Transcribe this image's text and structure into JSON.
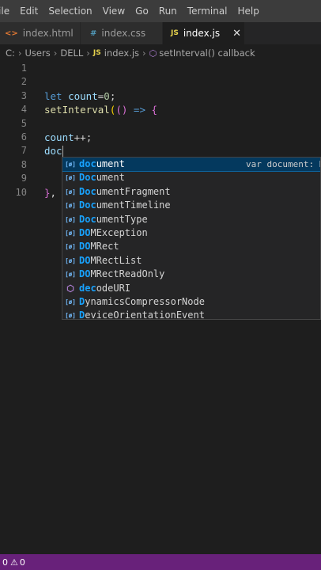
{
  "menu": [
    "File",
    "Edit",
    "Selection",
    "View",
    "Go",
    "Run",
    "Terminal",
    "Help"
  ],
  "tabs": [
    {
      "icon": "<>",
      "label": "index.html"
    },
    {
      "icon": "#",
      "label": "index.css"
    },
    {
      "icon": "JS",
      "label": "index.js",
      "close": "✕"
    }
  ],
  "breadcrumb": {
    "items": [
      "C:",
      "Users",
      "DELL",
      "index.js",
      "setInterval() callback"
    ],
    "sep": "›"
  },
  "editor": {
    "lines": [
      {
        "n": "1"
      },
      {
        "n": "2"
      },
      {
        "n": "3"
      },
      {
        "n": "4"
      },
      {
        "n": "5"
      },
      {
        "n": "6"
      },
      {
        "n": "7"
      },
      {
        "n": "8"
      },
      {
        "n": "9"
      },
      {
        "n": "10"
      }
    ],
    "tokens": {
      "let": "let",
      "count": "count",
      "eq": "=",
      "zero": "0",
      "semi": ";",
      "setInterval": "setInterval",
      "paren_open": "(",
      "arrow_parens": "()",
      "arrow": " => ",
      "brace_open": "{",
      "count2": "count",
      "inc": "++;",
      "typed": "doc",
      "brace_close": "}",
      "comma": ","
    }
  },
  "suggestions": {
    "icons": {
      "variable": "[ø]",
      "method": "⬡"
    },
    "items": [
      {
        "match": "doc",
        "rest": "ument",
        "kind": "variable",
        "detail": "var document: Do"
      },
      {
        "match": "Doc",
        "rest": "ument",
        "kind": "variable"
      },
      {
        "match": "Doc",
        "rest": "umentFragment",
        "kind": "variable"
      },
      {
        "match": "Doc",
        "rest": "umentTimeline",
        "kind": "variable"
      },
      {
        "match": "Doc",
        "rest": "umentType",
        "kind": "variable"
      },
      {
        "pre": "",
        "match": "DO",
        "mid": "M",
        "rest": "Exception",
        "kind": "variable"
      },
      {
        "match": "DO",
        "rest": "MRect",
        "kind": "variable"
      },
      {
        "match": "DO",
        "rest": "MRectList",
        "kind": "variable"
      },
      {
        "match": "DO",
        "rest": "MRectReadOnly",
        "kind": "variable"
      },
      {
        "match": "dec",
        "rest": "odeURI",
        "kind": "method"
      },
      {
        "match": "D",
        "rest": "ynamicsCompressorNode",
        "kind": "variable"
      },
      {
        "match": "D",
        "rest": "eviceOrientationEvent",
        "kind": "variable"
      }
    ]
  },
  "status": {
    "errors": "0",
    "warnings": "0"
  }
}
